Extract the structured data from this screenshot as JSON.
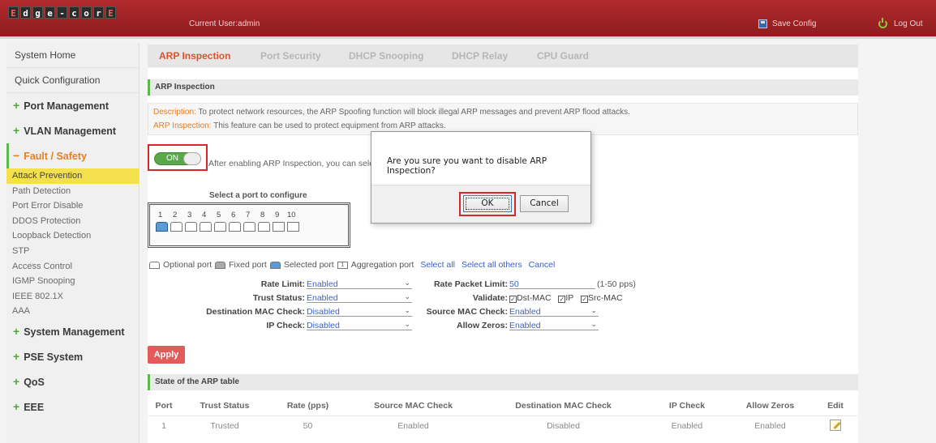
{
  "header": {
    "logo_letters": [
      "E",
      "d",
      "g",
      "e",
      "-",
      "c",
      "o",
      "r",
      "E"
    ],
    "current_user": "Current User:admin",
    "save_config": "Save Config",
    "log_out": "Log Out"
  },
  "sidebar": {
    "top_items": [
      "System Home",
      "Quick Configuration"
    ],
    "groups_before": [
      "Port Management",
      "VLAN Management"
    ],
    "open_group": "Fault / Safety",
    "sub_items": [
      "Attack Prevention",
      "Path Detection",
      "Port Error Disable",
      "DDOS Protection",
      "Loopback Detection",
      "STP",
      "Access Control",
      "IGMP Snooping",
      "IEEE 802.1X",
      "AAA"
    ],
    "active_sub": "Attack Prevention",
    "groups_after": [
      "System Management",
      "PSE System",
      "QoS",
      "EEE"
    ]
  },
  "tabs": [
    "ARP Inspection",
    "Port Security",
    "DHCP Snooping",
    "DHCP Relay",
    "CPU Guard"
  ],
  "active_tab": "ARP Inspection",
  "section_title": "ARP Inspection",
  "description": {
    "label1": "Description:",
    "text1": " To protect network resources, the ARP Spoofing function will block illegal ARP messages and prevent ARP flood attacks.",
    "label2": "ARP Inspection:",
    "text2": " This feature can be used to protect equipment from ARP attacks."
  },
  "toggle": {
    "label": "ON",
    "after_text": "After enabling ARP Inspection, you can select"
  },
  "port_panel": {
    "title": "Select a port to configure",
    "ports": [
      "1",
      "2",
      "3",
      "4",
      "5",
      "6",
      "7",
      "8",
      "9",
      "10"
    ]
  },
  "legend": {
    "optional": "Optional port",
    "fixed": "Fixed port",
    "selected": "Selected port",
    "aggregation": "Aggregation port",
    "agg_num": "1",
    "select_all": "Select all",
    "select_all_others": "Select all others",
    "cancel": "Cancel"
  },
  "config": {
    "rate_limit_label": "Rate Limit:",
    "rate_limit": "Enabled",
    "trust_status_label": "Trust Status:",
    "trust_status": "Enabled",
    "dest_mac_label": "Destination MAC Check:",
    "dest_mac": "Disabled",
    "ip_check_label": "IP Check:",
    "ip_check": "Disabled",
    "rate_packet_label": "Rate Packet Limit:",
    "rate_packet": "50",
    "rate_packet_hint": "(1-50 pps)",
    "validate_label": "Validate:",
    "validate_opts": [
      "Dst-MAC",
      "IP",
      "Src-MAC"
    ],
    "source_mac_label": "Source MAC Check:",
    "source_mac": "Enabled",
    "allow_zeros_label": "Allow Zeros:",
    "allow_zeros": "Enabled"
  },
  "apply_label": "Apply",
  "table_title": "State of the ARP table",
  "table": {
    "headers": [
      "Port",
      "Trust Status",
      "Rate (pps)",
      "Source MAC Check",
      "Destination MAC Check",
      "IP Check",
      "Allow Zeros",
      "Edit"
    ],
    "rows": [
      [
        "1",
        "Trusted",
        "50",
        "Enabled",
        "Disabled",
        "Enabled",
        "Enabled"
      ]
    ]
  },
  "dialog": {
    "message": "Are you sure you want to disable ARP Inspection?",
    "ok": "OK",
    "cancel": "Cancel"
  },
  "colors": {
    "header_red": "#9e2224",
    "accent_orange": "#e67e22",
    "on_green": "#5aa84a",
    "highlight_red": "#d9262a",
    "active_yellow": "#f4e04d"
  }
}
